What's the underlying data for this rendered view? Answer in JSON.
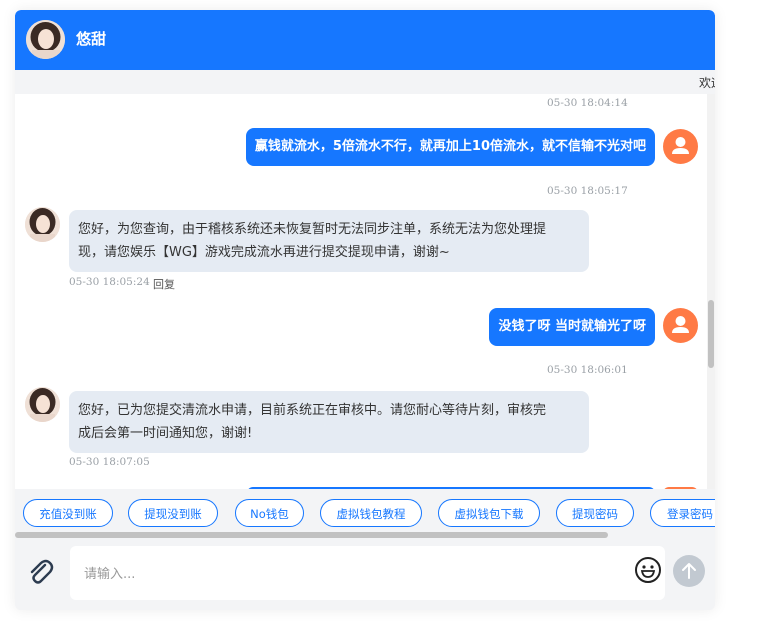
{
  "header": {
    "title": "悠甜"
  },
  "marquee": {
    "text": "欢迎"
  },
  "messages": [
    {
      "type": "timestamp",
      "text": "05-30 18:04:14"
    },
    {
      "type": "outgoing",
      "text": "赢钱就流水，5倍流水不行，就再加上10倍流水，就不信输不光对吧"
    },
    {
      "type": "timestamp",
      "text": "05-30 18:05:17"
    },
    {
      "type": "incoming",
      "lines": [
        "您好，为您查询，由于稽核系统还未恢复暂时无法同步注单，系统无法为您处理提",
        "现，请您娱乐【WG】游戏完成流水再进行提交提现申请，谢谢~"
      ],
      "time": "05-30 18:05:24",
      "reply": "回复"
    },
    {
      "type": "outgoing",
      "text": "没钱了呀 当时就输光了呀"
    },
    {
      "type": "timestamp",
      "text": "05-30 18:06:01"
    },
    {
      "type": "incoming",
      "lines": [
        "您好，已为您提交清流水申请，目前系统正在审核中。请您耐心等待片刻，审核完",
        "成后会第一时间通知您，谢谢!"
      ],
      "time": "05-30 18:07:05"
    }
  ],
  "quick_replies": [
    "充值没到账",
    "提现没到账",
    "No钱包",
    "虚拟钱包教程",
    "虚拟钱包下载",
    "提现密码",
    "登录密码"
  ],
  "input": {
    "placeholder": "请输入..."
  },
  "colors": {
    "primary": "#1677ff",
    "user_avatar": "#ff7a45",
    "incoming_bubble": "#e5ebf3"
  }
}
